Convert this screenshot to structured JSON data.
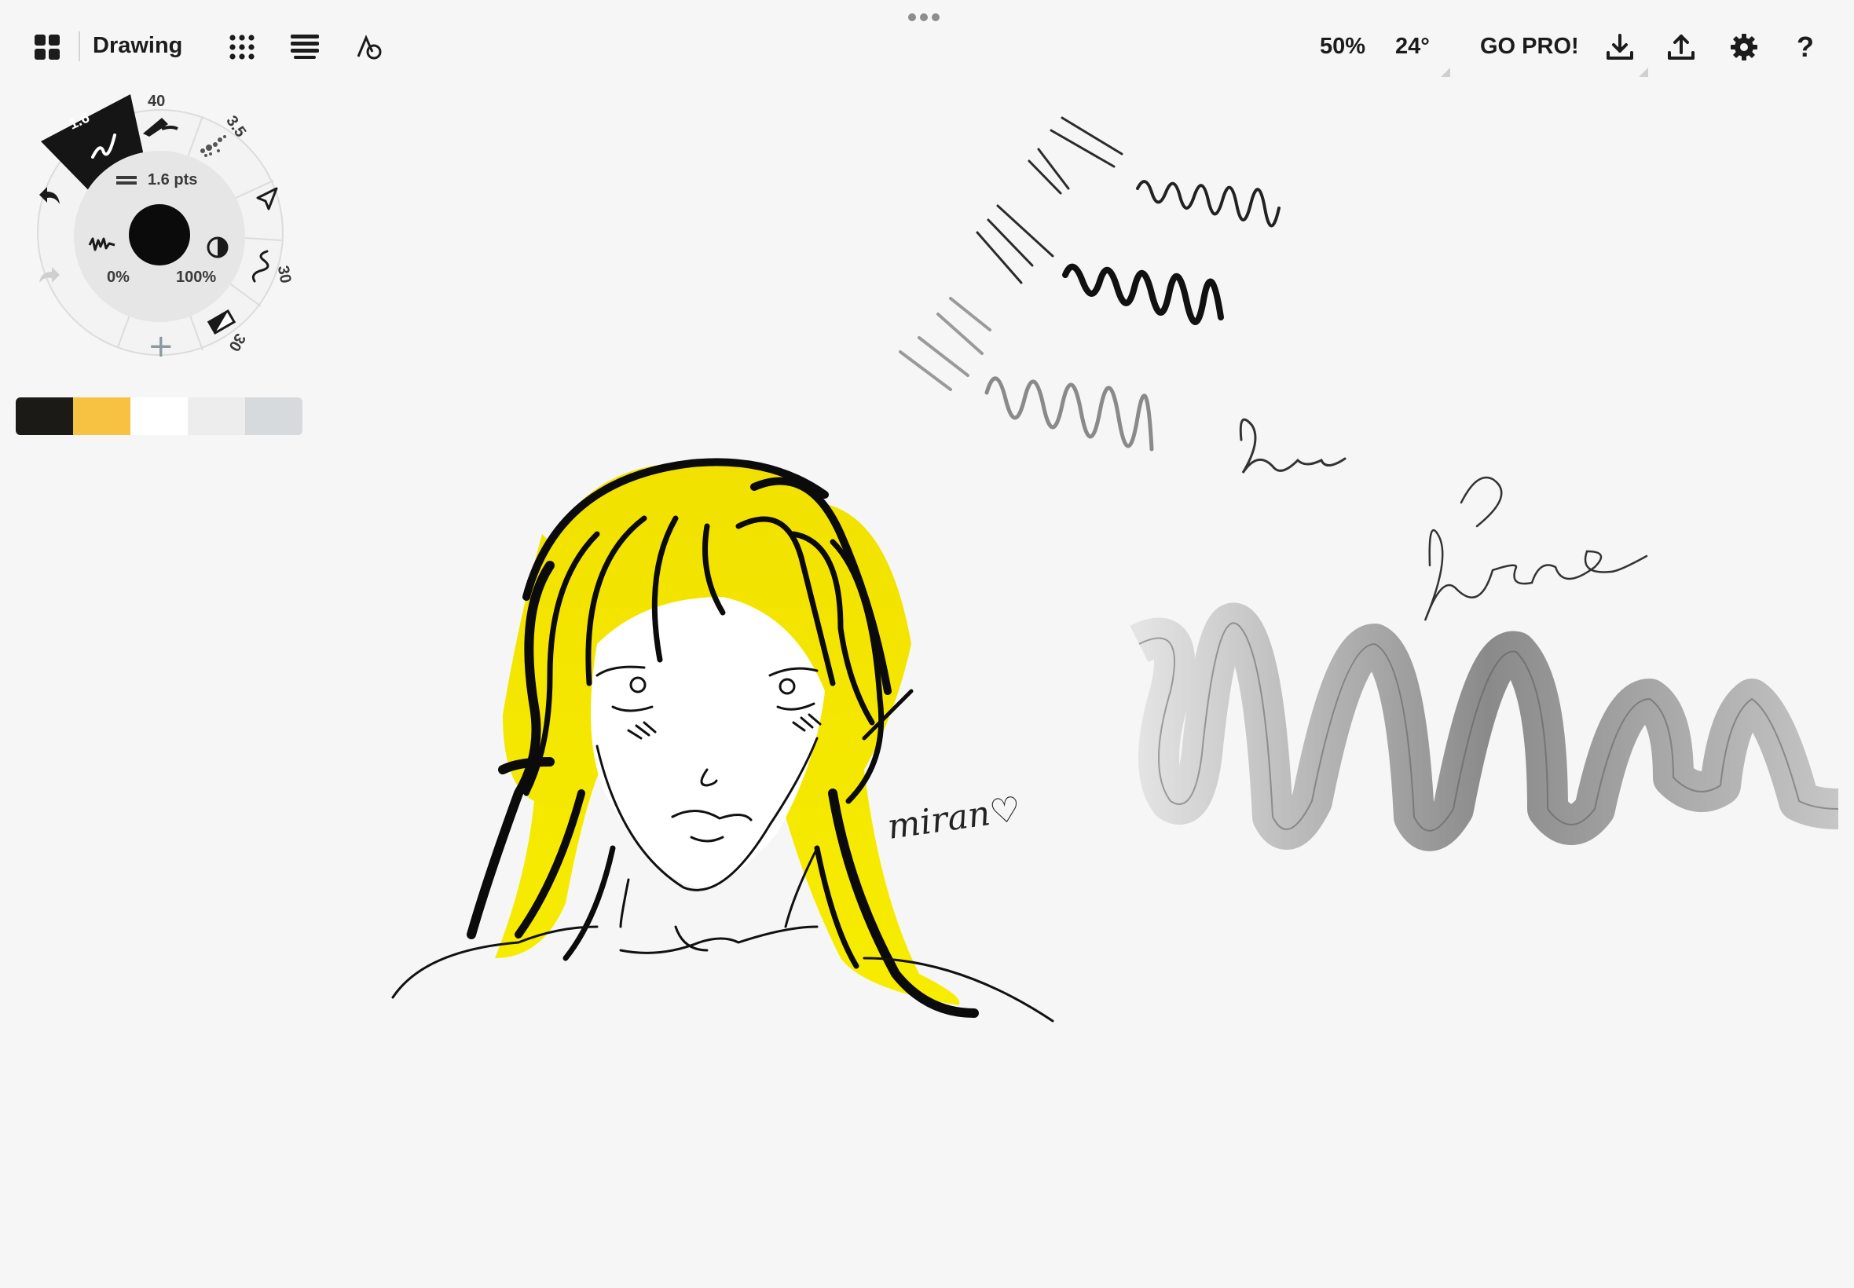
{
  "app": {
    "title": "Drawing"
  },
  "topbar": {
    "zoom": "50%",
    "rotation": "24°",
    "go_pro": "GO PRO!"
  },
  "tool_wheel": {
    "active_brush_size": "1.6",
    "brush_size_top": "40",
    "brush_size_pencil": "3.5",
    "brush_size_pen": "30",
    "brush_size_eraser": "30",
    "stroke_size": "1.6 pts",
    "smoothing": "0%",
    "opacity": "100%",
    "add_label": "+"
  },
  "palette": {
    "colors": [
      "#1b1a17",
      "#f7c242",
      "#ffffff",
      "#ededed",
      "#d7dadc"
    ]
  },
  "canvas": {
    "signature": "miran♡"
  }
}
